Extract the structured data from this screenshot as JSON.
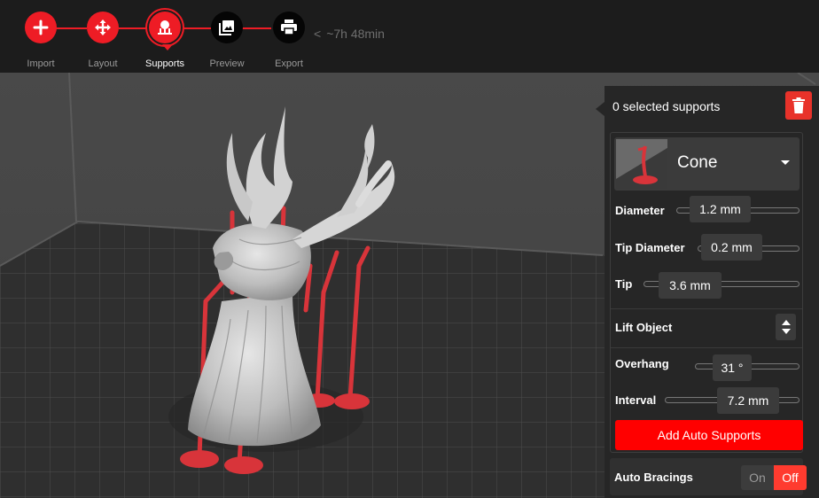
{
  "toolbar": {
    "steps": [
      {
        "label": "Import",
        "icon": "plus-icon",
        "state": "done"
      },
      {
        "label": "Layout",
        "icon": "move-arrows-icon",
        "state": "done"
      },
      {
        "label": "Supports",
        "icon": "supports-icon",
        "state": "active"
      },
      {
        "label": "Preview",
        "icon": "image-icon",
        "state": "todo"
      },
      {
        "label": "Export",
        "icon": "printer-icon",
        "state": "todo"
      }
    ],
    "time_estimate": "~7h 48min"
  },
  "panel": {
    "selected_text": "0 selected supports",
    "support_type": "Cone",
    "diameter": {
      "label": "Diameter",
      "value": "1.2 mm"
    },
    "tip_diameter": {
      "label": "Tip Diameter",
      "value": "0.2 mm"
    },
    "tip": {
      "label": "Tip",
      "value": "3.6 mm"
    },
    "lift_object": {
      "label": "Lift Object"
    },
    "overhang": {
      "label": "Overhang",
      "value": "31 °"
    },
    "interval": {
      "label": "Interval",
      "value": "7.2 mm"
    },
    "add_auto_supports": "Add Auto Supports",
    "auto_bracings": {
      "label": "Auto Bracings",
      "on": "On",
      "off": "Off",
      "state": "off"
    }
  },
  "colors": {
    "accent": "#ee1c25",
    "support_red": "#d8343a",
    "panel_bg": "#262626",
    "toolbar_bg": "#1c1c1c"
  }
}
